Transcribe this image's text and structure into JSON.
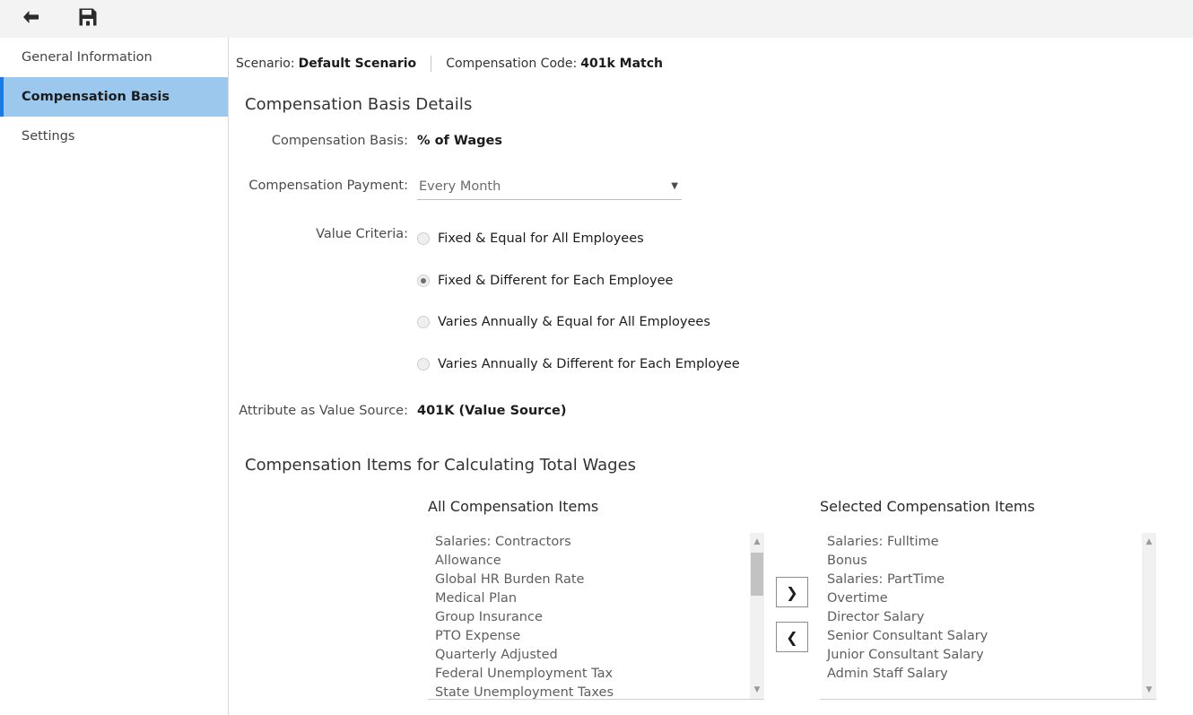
{
  "toolbar": {
    "back_label": "Back",
    "back_icon": "arrow-left-icon",
    "save_label": "Save",
    "save_icon": "floppy-disk-save-icon"
  },
  "sidebar": {
    "items": [
      {
        "label": "General Information",
        "active": false
      },
      {
        "label": "Compensation Basis",
        "active": true
      },
      {
        "label": "Settings",
        "active": false
      }
    ]
  },
  "breadcrumb": {
    "scenario_label": "Scenario:",
    "scenario_value": "Default Scenario",
    "code_label": "Compensation Code:",
    "code_value": "401k Match"
  },
  "details": {
    "title": "Compensation Basis Details",
    "basis_label": "Compensation Basis:",
    "basis_value": "% of Wages",
    "payment_label": "Compensation Payment:",
    "payment_value": "Every Month",
    "payment_caret": "▼",
    "criteria_label": "Value Criteria:",
    "criteria_options": [
      {
        "label": "Fixed & Equal for All Employees",
        "selected": false
      },
      {
        "label": "Fixed & Different for Each Employee",
        "selected": true
      },
      {
        "label": "Varies Annually & Equal for All Employees",
        "selected": false
      },
      {
        "label": "Varies Annually & Different for Each Employee",
        "selected": false
      }
    ],
    "attribute_label": "Attribute as Value Source:",
    "attribute_value": "401K (Value Source)"
  },
  "transfer": {
    "title": "Compensation Items for Calculating Total Wages",
    "left_header": "All Compensation Items",
    "right_header": "Selected Compensation Items",
    "add_button_label": "❯",
    "remove_button_label": "❮",
    "scroll_up_glyph": "▲",
    "scroll_down_glyph": "▼",
    "left_items": [
      "Salaries: Contractors",
      "Allowance",
      "Global HR Burden Rate",
      "Medical Plan",
      "Group Insurance",
      "PTO Expense",
      "Quarterly Adjusted",
      "Federal Unemployment Tax",
      "State Unemployment Taxes"
    ],
    "right_items": [
      "Salaries: Fulltime",
      "Bonus",
      "Salaries: PartTime",
      "Overtime",
      "Director Salary",
      "Senior Consultant Salary",
      "Junior Consultant Salary",
      "Admin Staff Salary"
    ]
  },
  "colors": {
    "accent": "#1a7ae8",
    "active_bg": "#9cc8ee",
    "toolbar_bg": "#f3f3f3",
    "text": "#1c1c1c",
    "muted": "#5e5e5e"
  }
}
